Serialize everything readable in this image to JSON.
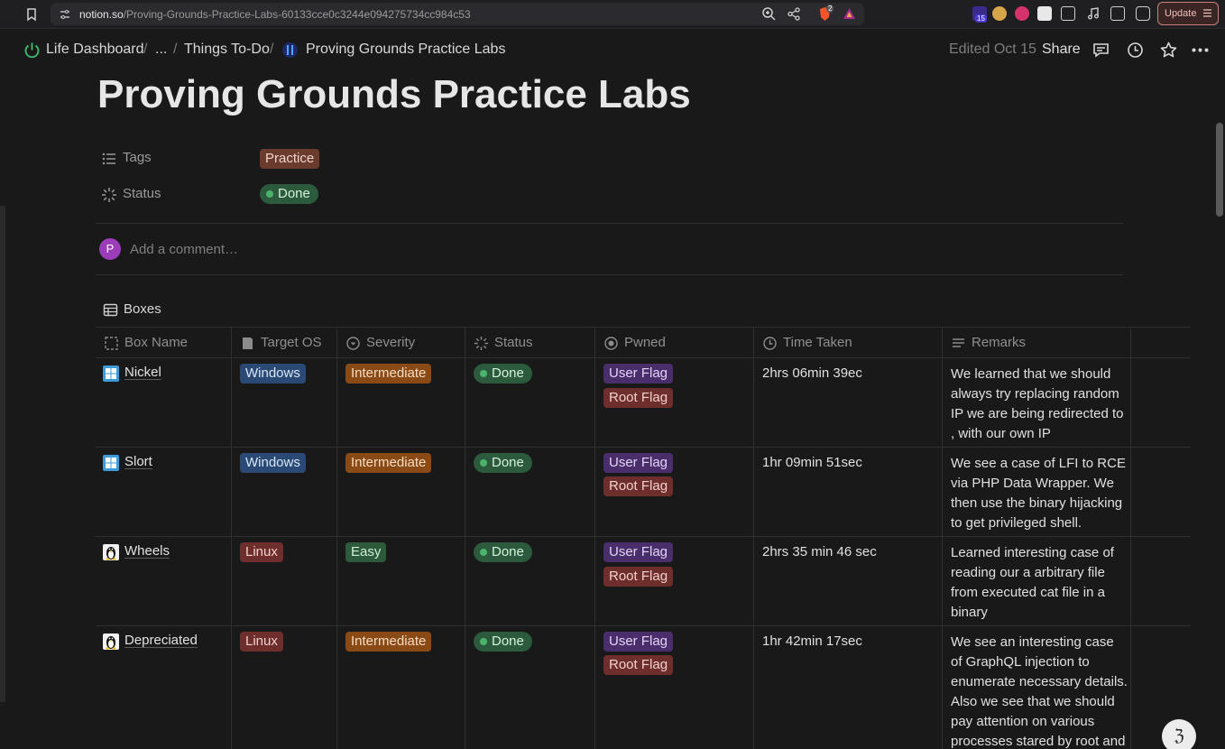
{
  "browser": {
    "url_host": "notion.so",
    "url_path": "/Proving-Grounds-Practice-Labs-60133cce0c3244e094275734cc984c53",
    "update_label": "Update",
    "extension_badge": "15",
    "brave_badge": "2"
  },
  "header": {
    "breadcrumbs": [
      "Life Dashboard",
      "...",
      "Things To-Do",
      "Proving Grounds Practice Labs"
    ],
    "separator": "/",
    "edited": "Edited Oct 15",
    "share": "Share"
  },
  "page": {
    "title": "Proving Grounds Practice Labs",
    "properties": [
      {
        "label": "Tags",
        "value": "Practice"
      },
      {
        "label": "Status",
        "value": "Done"
      }
    ],
    "comment": {
      "avatar_initial": "P",
      "placeholder": "Add a comment…"
    }
  },
  "database": {
    "title": "Boxes",
    "columns": [
      "Box Name",
      "Target OS",
      "Severity",
      "Status",
      "Pwned",
      "Time Taken",
      "Remarks"
    ],
    "rows": [
      {
        "name": "Nickel",
        "os": "Windows",
        "severity": "Intermediate",
        "status": "Done",
        "pwned": [
          "User Flag",
          "Root Flag"
        ],
        "time": "2hrs 06min 39ec",
        "remarks": "We learned that we should always try replacing random IP we are being redirected to , with our own IP"
      },
      {
        "name": "Slort",
        "os": "Windows",
        "severity": "Intermediate",
        "status": "Done",
        "pwned": [
          "User Flag",
          "Root Flag"
        ],
        "time": "1hr 09min 51sec",
        "remarks": "We see a case of LFI to RCE via PHP Data Wrapper. We then use the binary hijacking to get privileged shell."
      },
      {
        "name": "Wheels",
        "os": "Linux",
        "severity": "Easy",
        "status": "Done",
        "pwned": [
          "User Flag",
          "Root Flag"
        ],
        "time": "2hrs 35 min 46 sec",
        "remarks": "Learned interesting case of reading our a arbitrary file from executed cat file in a binary"
      },
      {
        "name": "Depreciated",
        "os": "Linux",
        "severity": "Intermediate",
        "status": "Done",
        "pwned": [
          "User Flag",
          "Root Flag"
        ],
        "time": "1hr 42min 17sec",
        "remarks": "We see an interesting case of GraphQL injection to enumerate necessary details. Also we see that we should pay attention on various processes stared by root and"
      }
    ]
  },
  "icons": {
    "page": "proving-grounds-logo-icon",
    "windows": "windows-icon",
    "linux": "linux-penguin-icon"
  },
  "colors": {
    "background": "#191919",
    "done_dot": "#4bb36c",
    "tag_practice": "#6b3b2e",
    "tag_windows": "#2a4a75",
    "tag_linux": "#6e2e2b",
    "tag_intermediate": "#8a4a16",
    "tag_easy": "#2c5a3a",
    "tag_user_flag": "#4a2e6c",
    "tag_root_flag": "#6e2e2b"
  },
  "helper": {
    "glyph": "ℨ"
  }
}
